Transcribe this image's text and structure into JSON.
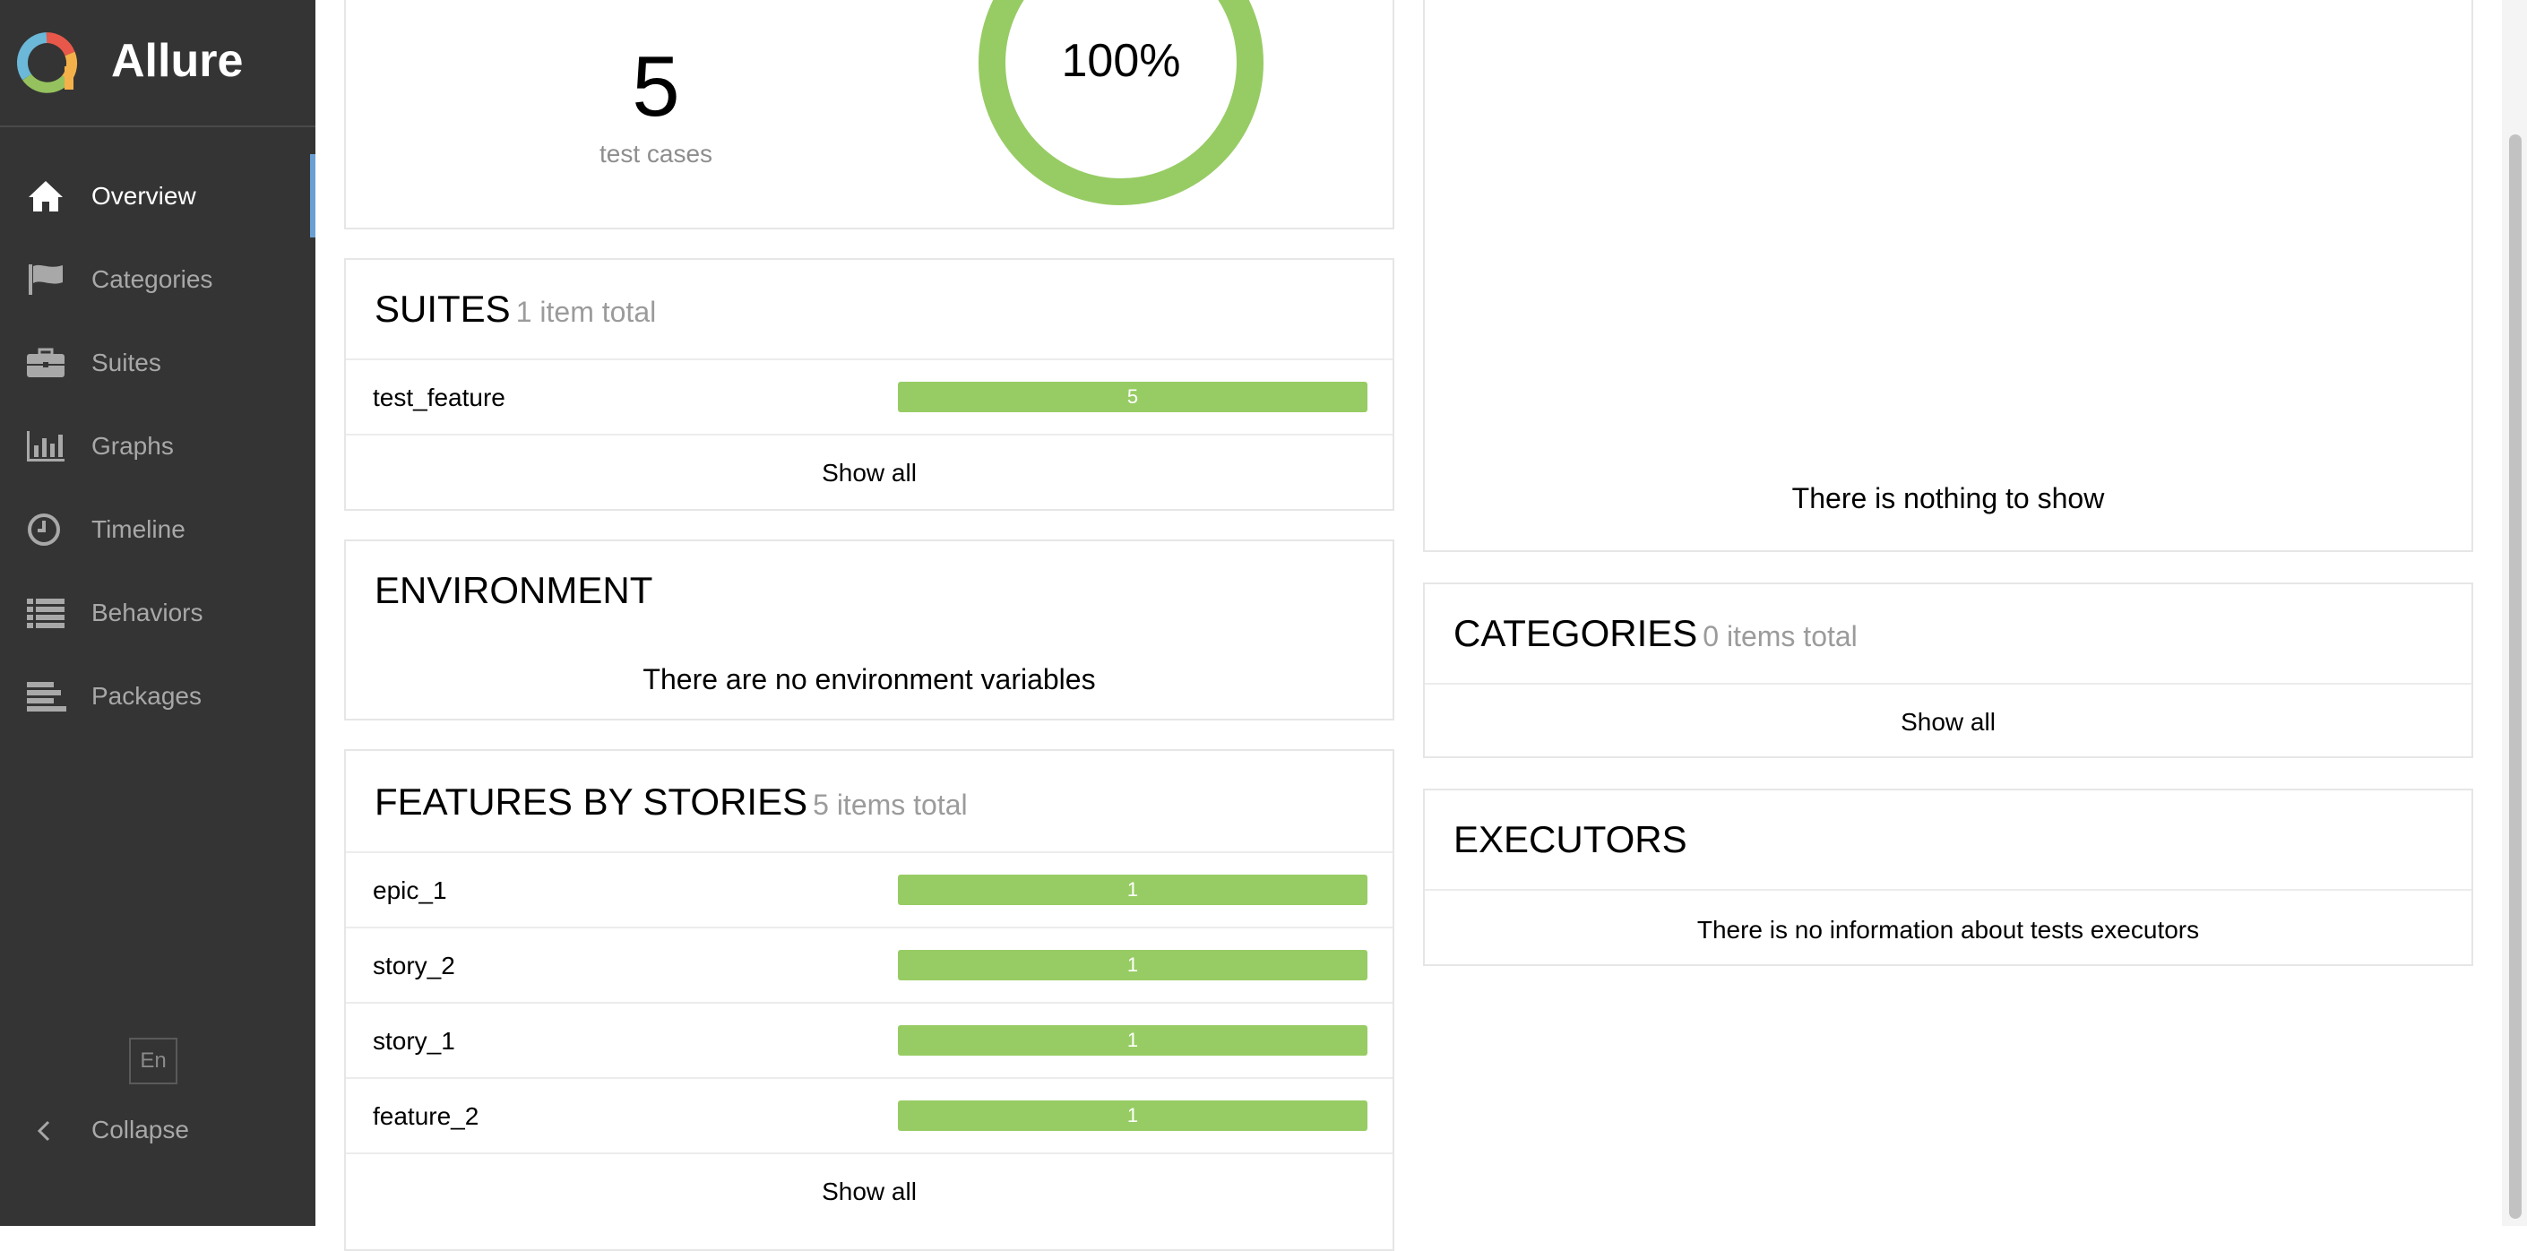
{
  "sidebar": {
    "brand": "Allure",
    "items": [
      {
        "label": "Overview",
        "icon": "home-icon",
        "active": true
      },
      {
        "label": "Categories",
        "icon": "flag-icon"
      },
      {
        "label": "Suites",
        "icon": "briefcase-icon"
      },
      {
        "label": "Graphs",
        "icon": "bar-chart-icon"
      },
      {
        "label": "Timeline",
        "icon": "clock-icon"
      },
      {
        "label": "Behaviors",
        "icon": "list-icon"
      },
      {
        "label": "Packages",
        "icon": "align-left-icon"
      }
    ],
    "language": "En",
    "collapse_label": "Collapse"
  },
  "summary": {
    "test_count": "5",
    "test_count_label": "test cases",
    "success_rate": "100%",
    "success_fraction": 1.0
  },
  "suites": {
    "title": "SUITES",
    "count_label": "1 item total",
    "rows": [
      {
        "name": "test_feature",
        "value": "5"
      }
    ],
    "show_all": "Show all"
  },
  "environment": {
    "title": "ENVIRONMENT",
    "message": "There are no environment variables"
  },
  "features": {
    "title": "FEATURES BY STORIES",
    "count_label": "5 items total",
    "rows": [
      {
        "name": "epic_1",
        "value": "1"
      },
      {
        "name": "story_2",
        "value": "1"
      },
      {
        "name": "story_1",
        "value": "1"
      },
      {
        "name": "feature_2",
        "value": "1"
      }
    ],
    "show_all": "Show all"
  },
  "trend": {
    "message": "There is nothing to show"
  },
  "categories": {
    "title": "CATEGORIES",
    "count_label": "0 items total",
    "show_all": "Show all"
  },
  "executors": {
    "title": "EXECUTORS",
    "message": "There is no information about tests executors"
  },
  "colors": {
    "sidebar_bg": "#343434",
    "active_marker": "#6a9fd4",
    "passed": "#97cc64"
  }
}
